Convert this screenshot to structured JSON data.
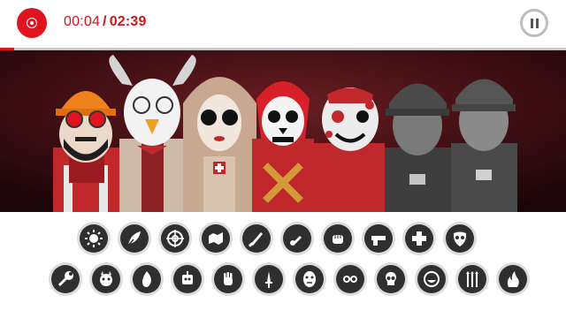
{
  "recording": {
    "icon": "record-icon",
    "color": "#e0141e"
  },
  "timer": {
    "elapsed": "00:04",
    "separator": "/",
    "total": "02:39"
  },
  "progress": {
    "fraction": 0.025
  },
  "pause": {
    "icon": "pause-icon"
  },
  "stage": {
    "background": "#2a0a10"
  },
  "icons_row1": [
    {
      "name": "sun-gear-icon"
    },
    {
      "name": "feather-icon"
    },
    {
      "name": "crosshair-icon"
    },
    {
      "name": "map-icon"
    },
    {
      "name": "knife-icon"
    },
    {
      "name": "bullet-icon"
    },
    {
      "name": "fist-icon"
    },
    {
      "name": "gun-icon"
    },
    {
      "name": "medical-cross-icon"
    },
    {
      "name": "mask-icon"
    }
  ],
  "icons_row2": [
    {
      "name": "wrench-icon"
    },
    {
      "name": "devil-icon"
    },
    {
      "name": "flame-icon"
    },
    {
      "name": "robot-icon"
    },
    {
      "name": "hand-icon"
    },
    {
      "name": "dagger-icon"
    },
    {
      "name": "face-icon"
    },
    {
      "name": "goggles-icon"
    },
    {
      "name": "skull-icon"
    },
    {
      "name": "grin-icon"
    },
    {
      "name": "arrows-icon"
    },
    {
      "name": "fire-icon"
    }
  ]
}
